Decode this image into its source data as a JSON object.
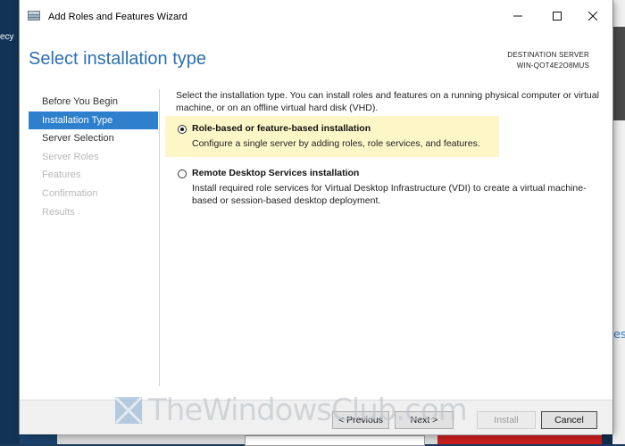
{
  "window": {
    "title": "Add Roles and Features Wizard"
  },
  "header": {
    "page_title": "Select installation type",
    "destination_label": "DESTINATION SERVER",
    "destination_server": "WIN-QOT4E2O8MUS"
  },
  "nav": {
    "items": [
      {
        "label": "Before You Begin",
        "state": "normal"
      },
      {
        "label": "Installation Type",
        "state": "active"
      },
      {
        "label": "Server Selection",
        "state": "normal"
      },
      {
        "label": "Server Roles",
        "state": "disabled"
      },
      {
        "label": "Features",
        "state": "disabled"
      },
      {
        "label": "Confirmation",
        "state": "disabled"
      },
      {
        "label": "Results",
        "state": "disabled"
      }
    ]
  },
  "content": {
    "intro": "Select the installation type. You can install roles and features on a running physical computer or virtual machine, or on an offline virtual hard disk (VHD).",
    "options": [
      {
        "title": "Role-based or feature-based installation",
        "description": "Configure a single server by adding roles, role services, and features.",
        "selected": true
      },
      {
        "title": "Remote Desktop Services installation",
        "description": "Install required role services for Virtual Desktop Infrastructure (VDI) to create a virtual machine-based or session-based desktop deployment.",
        "selected": false
      }
    ]
  },
  "footer": {
    "previous_label": "< Previous",
    "next_label": "Next >",
    "install_label": "Install",
    "cancel_label": "Cancel"
  },
  "desktop": {
    "left_fragment": "ecy",
    "right_fragment": "es"
  },
  "watermark": {
    "text": "TheWindowsClub.com"
  },
  "colors": {
    "accent": "#2e7fcc",
    "title_blue": "#2b6fb3",
    "highlight": "#fdf7c8"
  }
}
